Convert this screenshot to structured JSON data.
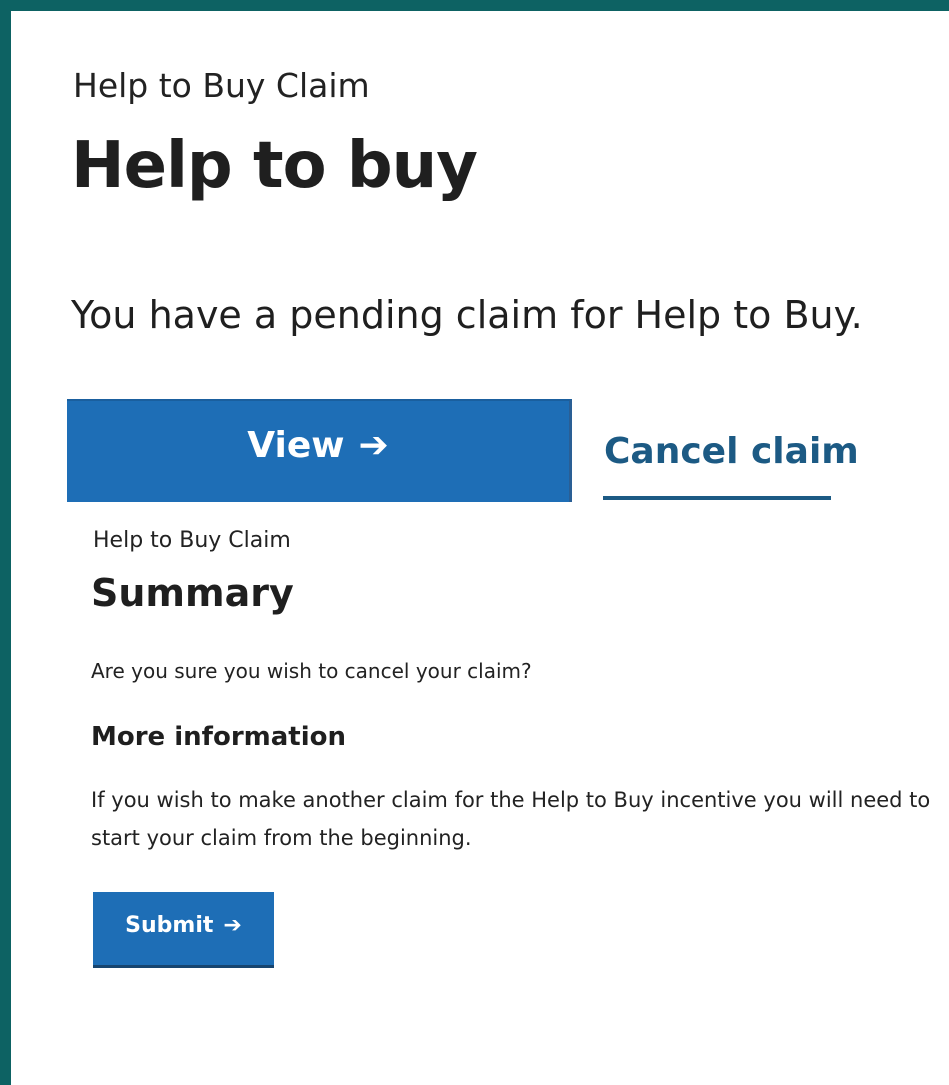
{
  "top": {
    "caption": "Help to Buy Claim",
    "title": "Help to buy",
    "pending_text": "You have a pending claim for Help to Buy.",
    "view_label": "View",
    "view_icon": "arrow-right-icon",
    "cancel_label": "Cancel claim"
  },
  "summary": {
    "caption": "Help to Buy Claim",
    "title": "Summary",
    "question": "Are you sure you wish to cancel your claim?",
    "more_heading": "More information",
    "info_text": "If you wish to make another claim for the Help to Buy incentive you will need to start your claim from the beginning.",
    "submit_label": "Submit",
    "submit_icon": "arrow-right-icon"
  },
  "colors": {
    "frame": "#0d6263",
    "button": "#1e6eb6",
    "link": "#1c5a84",
    "text": "#1f1f1f"
  }
}
